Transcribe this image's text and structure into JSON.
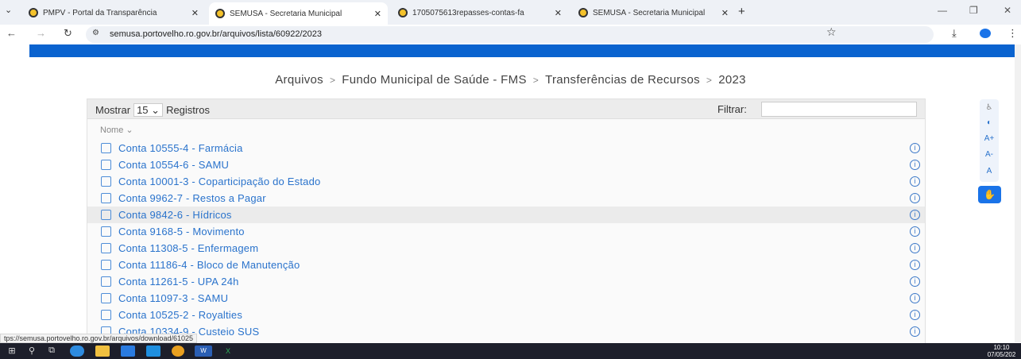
{
  "browser": {
    "tabs": [
      {
        "title": "PMPV - Portal da Transparência",
        "active": false
      },
      {
        "title": "SEMUSA - Secretaria Municipal",
        "active": true
      },
      {
        "title": "1705075613repasses-contas-fa",
        "active": false
      },
      {
        "title": "SEMUSA - Secretaria Municipal",
        "active": false
      }
    ],
    "url": "semusa.portovelho.ro.gov.br/arquivos/lista/60922/2023",
    "status_url": "tps://semusa.portovelho.ro.gov.br/arquivos/download/61025"
  },
  "breadcrumb": [
    "Arquivos",
    "Fundo Municipal de Saúde - FMS",
    "Transferências de Recursos",
    "2023"
  ],
  "table": {
    "show_label": "Mostrar",
    "page_size": "15",
    "records_label": "Registros",
    "filter_label": "Filtrar:",
    "filter_value": "",
    "column_name": "Nome",
    "rows": [
      {
        "label": "Conta 10555-4 - Farmácia",
        "type": "PDF"
      },
      {
        "label": "Conta 10554-6 - SAMU",
        "type": "PDF"
      },
      {
        "label": "Conta 10001-3 - Coparticipação do Estado",
        "type": "XLS"
      },
      {
        "label": "Conta 9962-7 - Restos a Pagar",
        "type": "XLS"
      },
      {
        "label": "Conta 9842-6 - Hídricos",
        "type": "XLS",
        "highlighted": true
      },
      {
        "label": "Conta 9168-5 - Movimento",
        "type": "XLS"
      },
      {
        "label": "Conta 11308-5 - Enfermagem",
        "type": "XLS"
      },
      {
        "label": "Conta 11186-4 - Bloco de Manutenção",
        "type": "XLS"
      },
      {
        "label": "Conta 11261-5 - UPA 24h",
        "type": "XLS"
      },
      {
        "label": "Conta 11097-3 - SAMU",
        "type": "XLS"
      },
      {
        "label": "Conta 10525-2 - Royalties",
        "type": "XLS"
      },
      {
        "label": "Conta 10334-9 - Custeio SUS",
        "type": "XLS"
      }
    ]
  },
  "accessibility": {
    "items": [
      "A+",
      "A-",
      "A"
    ],
    "icons": [
      "accessibility-icon",
      "contrast-icon",
      "sign-language-icon"
    ]
  },
  "clock": {
    "time": "10:10",
    "date": "07/05/202"
  },
  "colors": {
    "brand_blue": "#0a63cf",
    "link_blue": "#2a73cc",
    "taskbar": "#1d1f2b"
  }
}
